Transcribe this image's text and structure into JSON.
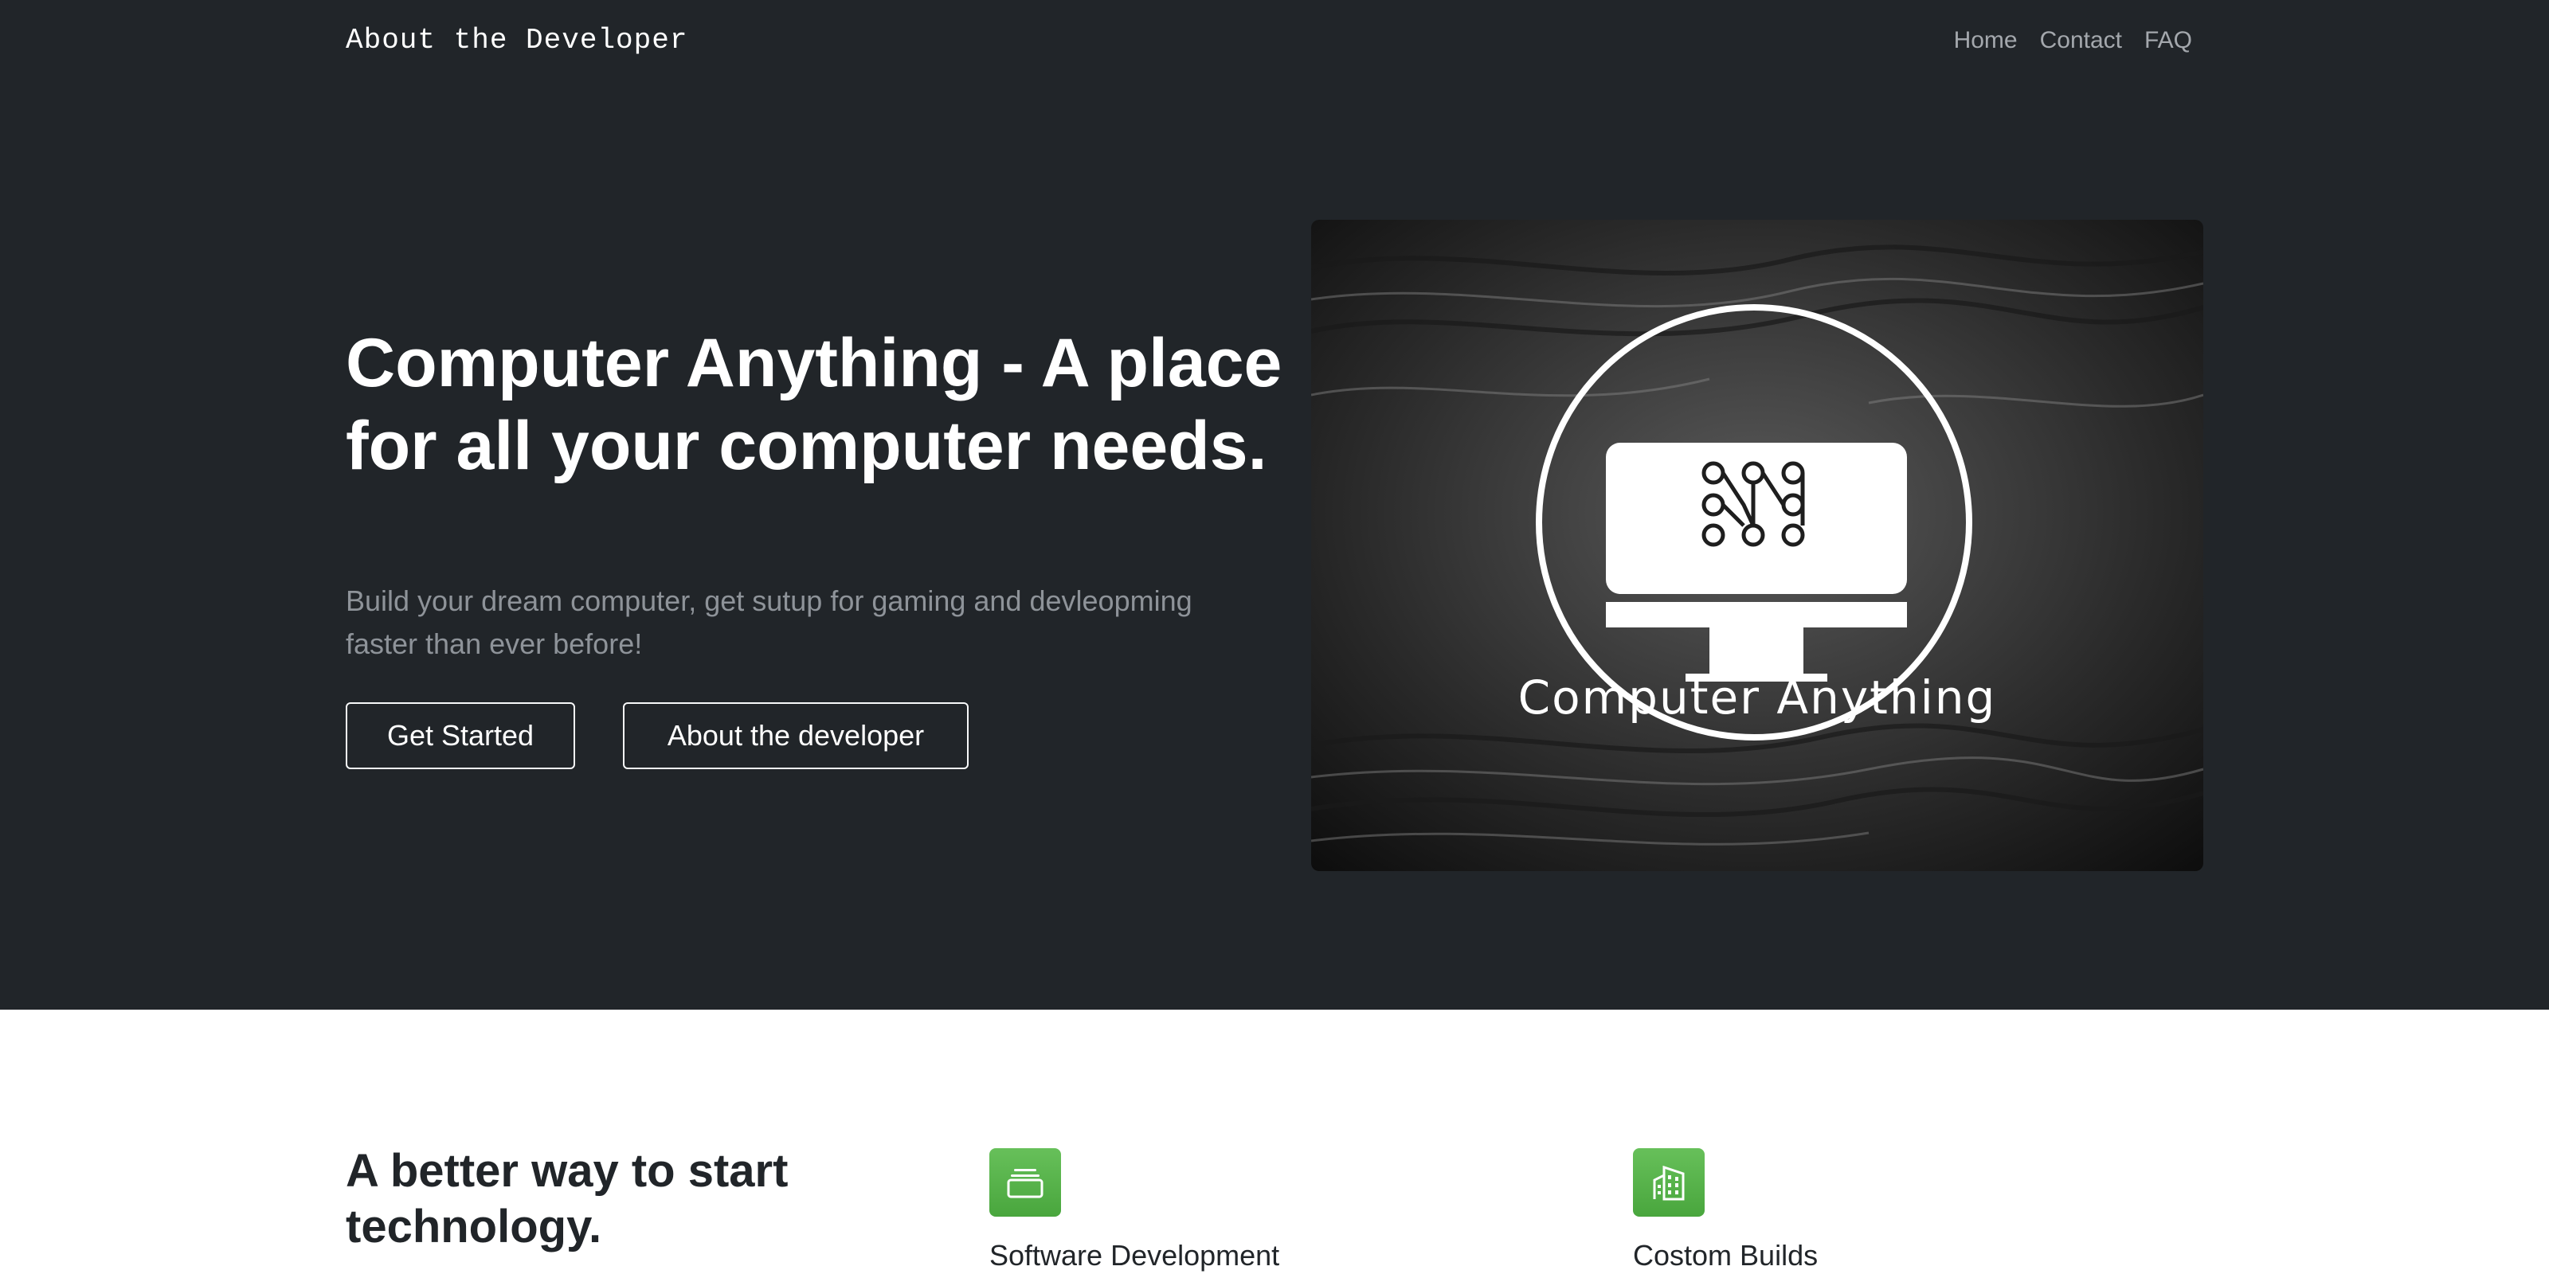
{
  "brand": "About the Developer",
  "nav": {
    "home": "Home",
    "contact": "Contact",
    "faq": "FAQ"
  },
  "hero": {
    "title": "Computer Anything - A place for all your computer needs.",
    "lead": "Build your dream computer, get sutup for gaming and devleopming faster than ever before!",
    "primary_button": "Get Started",
    "secondary_button": "About the developer",
    "logo_text": "Computer Anything"
  },
  "features": {
    "heading": "A better way to start technology.",
    "items": [
      {
        "title": "Software Development",
        "icon": "collection-icon"
      },
      {
        "title": "Costom Builds",
        "icon": "building-icon"
      }
    ]
  },
  "colors": {
    "hero_bg": "#212529",
    "accent_green": "#55b148",
    "text_muted": "#8e9399"
  }
}
